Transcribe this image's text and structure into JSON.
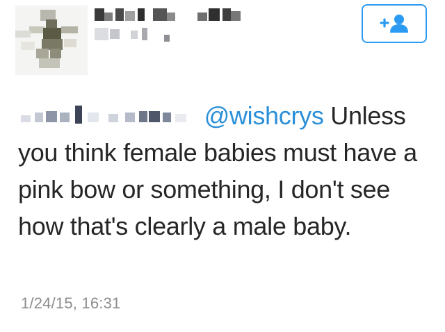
{
  "tweet": {
    "mention": "@wishcrys",
    "text_line1": " Unless",
    "text_rest": "you think female babies must have a pink bow or something, I don't see how that's clearly a male baby.",
    "timestamp": "1/24/15, 16:31"
  },
  "follow_button": {
    "icon": "follow-user-icon",
    "color": "#2b9af3"
  },
  "colors": {
    "mention": "#2b8fd8",
    "text": "#262626",
    "timestamp": "#8c8c8c"
  }
}
